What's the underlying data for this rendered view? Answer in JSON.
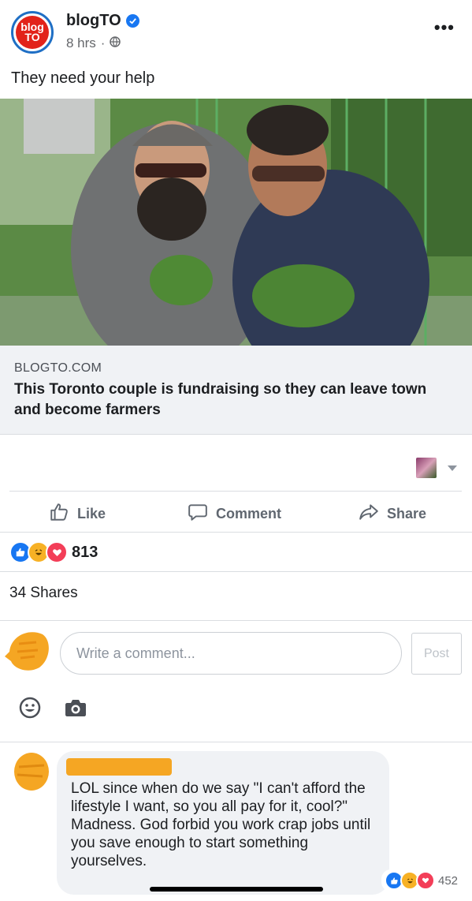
{
  "header": {
    "logo_line1": "blog",
    "logo_line2": "TO",
    "page_name": "blogTO",
    "time": "8 hrs",
    "separator": "·",
    "more_label": "•••"
  },
  "post": {
    "text": "They need your help"
  },
  "link_preview": {
    "domain": "BLOGTO.COM",
    "title": "This Toronto couple is fundraising so they can leave town and become farmers"
  },
  "actions": {
    "like": "Like",
    "comment": "Comment",
    "share": "Share"
  },
  "reactions": {
    "count": "813",
    "types": [
      "like-icon",
      "haha-icon",
      "love-icon"
    ]
  },
  "shares_text": "34 Shares",
  "composer": {
    "placeholder": "Write a comment...",
    "post_label": "Post"
  },
  "comment": {
    "text": "LOL since when do we say \"I can't afford the lifestyle I want, so you all pay for it, cool?\"\nMadness. God forbid you work crap jobs until you save enough to start something yourselves.",
    "reaction_count": "452"
  },
  "colors": {
    "accent": "#1877f2",
    "love": "#f33e58",
    "haha": "#f7b125",
    "redaction": "#f5a623"
  }
}
